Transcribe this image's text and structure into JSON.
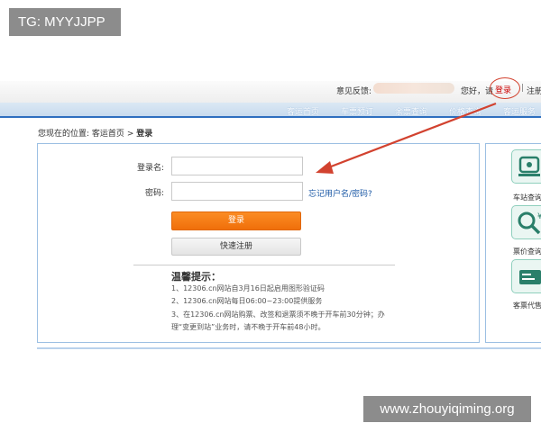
{
  "watermark": {
    "top_left": "TG: MYYJJPP",
    "bottom_right": "www.zhouyiqiming.org"
  },
  "header": {
    "feedback_label": "意见反馈:",
    "greeting": "您好，请",
    "login_link": "登录",
    "separator": "|",
    "register_link": "注册"
  },
  "nav": {
    "items": [
      "客运首页",
      "车票预订",
      "余票查询",
      "价格查询",
      "客运服务"
    ]
  },
  "breadcrumb": {
    "prefix": "您现在的位置:",
    "home": "客运首页",
    "separator": ">",
    "current": "登录"
  },
  "form": {
    "username_label": "登录名:",
    "password_label": "密码:",
    "username_value": "",
    "password_value": "",
    "forgot_link": "忘记用户名/密码?",
    "login_button": "登录",
    "quick_register_button": "快速注册"
  },
  "tips": {
    "title": "温馨提示：",
    "lines": [
      "1、12306.cn网站自3月16日起启用图形验证码",
      "2、12306.cn网站每日06:00~23:00提供服务",
      "3、在12306.cn网站购票、改签和退票须不晚于开车前30分钟；办",
      "理“变更到站”业务时，请不晚于开车前48小时。"
    ]
  },
  "side": {
    "items": [
      {
        "label": "车站查询",
        "icon": "station-query-icon"
      },
      {
        "label": "票价查询",
        "icon": "fare-query-icon"
      },
      {
        "label": "客票代售",
        "icon": "ticket-agent-icon"
      }
    ]
  },
  "colors": {
    "accent_orange": "#f07a14",
    "nav_blue": "#2e6fbf",
    "annotation_red": "#d2422f",
    "link_blue": "#1d5aa6"
  }
}
